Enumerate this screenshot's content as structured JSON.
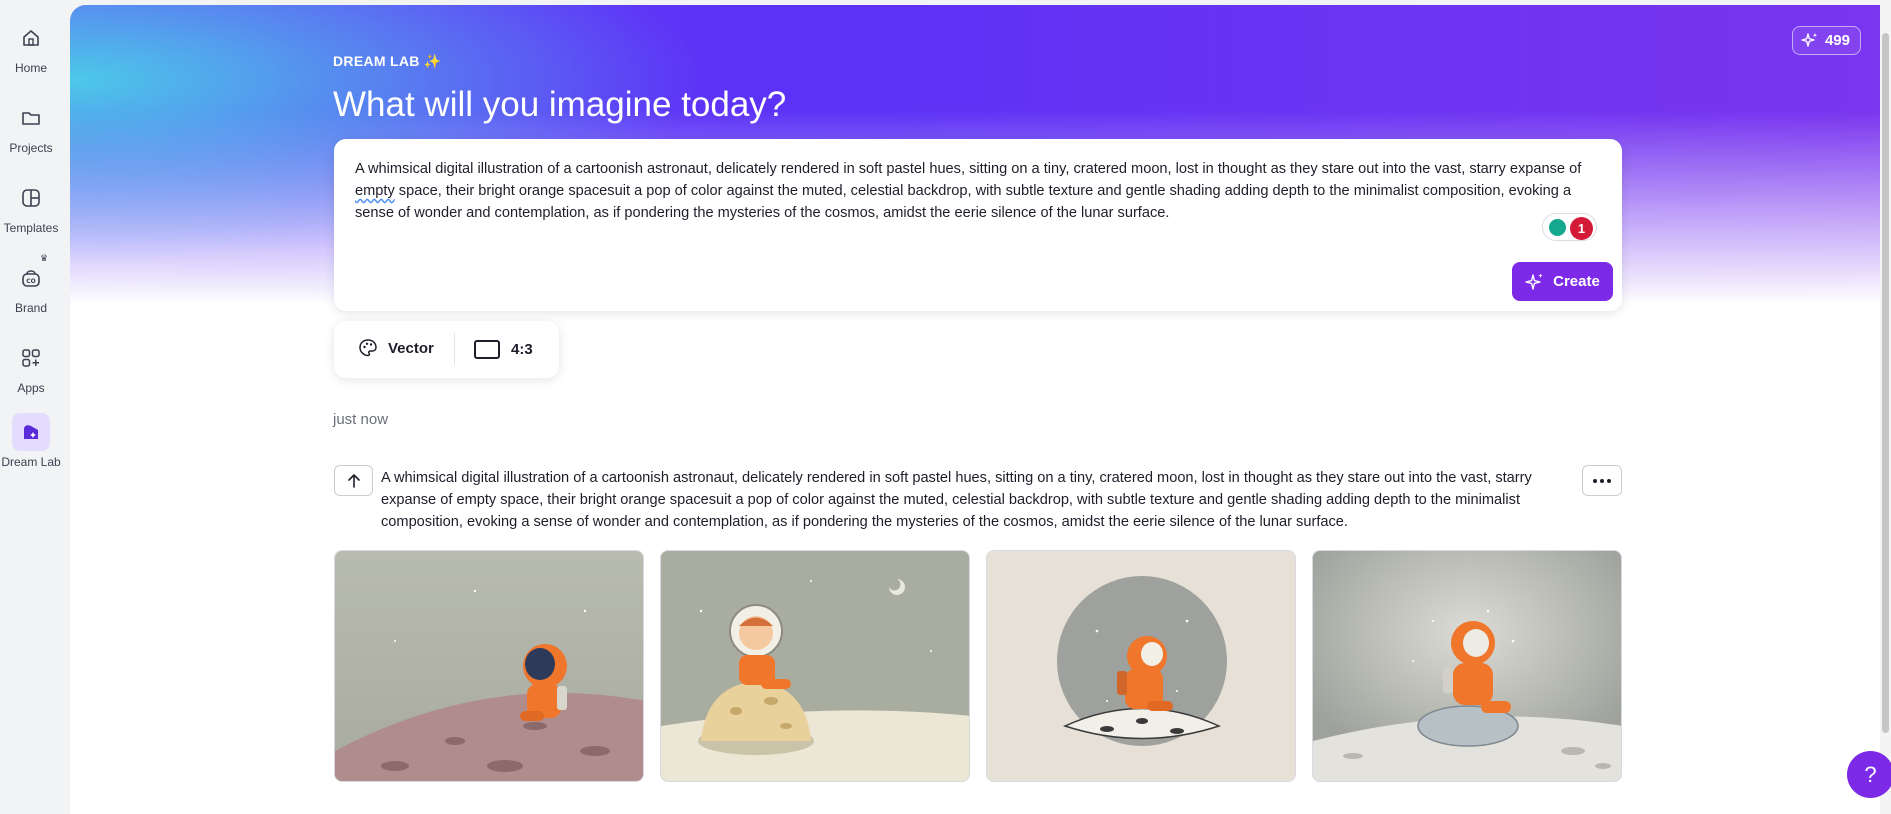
{
  "sidebar": {
    "items": [
      {
        "label": "Home",
        "icon": "home-icon"
      },
      {
        "label": "Projects",
        "icon": "folder-icon"
      },
      {
        "label": "Templates",
        "icon": "templates-icon"
      },
      {
        "label": "Brand",
        "icon": "brand-icon"
      },
      {
        "label": "Apps",
        "icon": "apps-icon"
      },
      {
        "label": "Dream Lab",
        "icon": "dream-lab-icon",
        "active": true
      }
    ]
  },
  "header": {
    "eyebrow": "DREAM LAB ✨",
    "title": "What will you imagine today?",
    "credits": "499"
  },
  "prompt": {
    "text_before": "A whimsical digital illustration of a cartoonish astronaut, delicately rendered in soft pastel hues, sitting on a tiny, cratered moon, lost in thought as they stare out into the vast, starry expanse of ",
    "text_flagged": "empty",
    "text_after": " space, their bright orange spacesuit a pop of color against the muted, celestial backdrop, with subtle texture and gentle shading adding depth to the minimalist composition, evoking a sense of wonder and contemplation, as if pondering the mysteries of the cosmos, amidst the eerie silence of the lunar surface.",
    "issue_count": "1",
    "create_label": "Create"
  },
  "options": {
    "style_label": "Vector",
    "aspect_label": "4:3"
  },
  "history": {
    "timestamp": "just now",
    "prompt_text": "A whimsical digital illustration of a cartoonish astronaut, delicately rendered in soft pastel hues, sitting on a tiny, cratered moon, lost in thought as they stare out into the vast, starry expanse of empty space, their bright orange spacesuit a pop of color against the muted, celestial backdrop, with subtle texture and gentle shading adding depth to the minimalist composition, evoking a sense of wonder and contemplation, as if pondering the mysteries of the cosmos, amidst the eerie silence of the lunar surface."
  },
  "colors": {
    "accent": "#7d2ae8",
    "hero_purple": "#5b32f6",
    "hero_cyan": "#4ad0e8",
    "spacesuit_orange": "#f0762c"
  },
  "help_label": "?"
}
